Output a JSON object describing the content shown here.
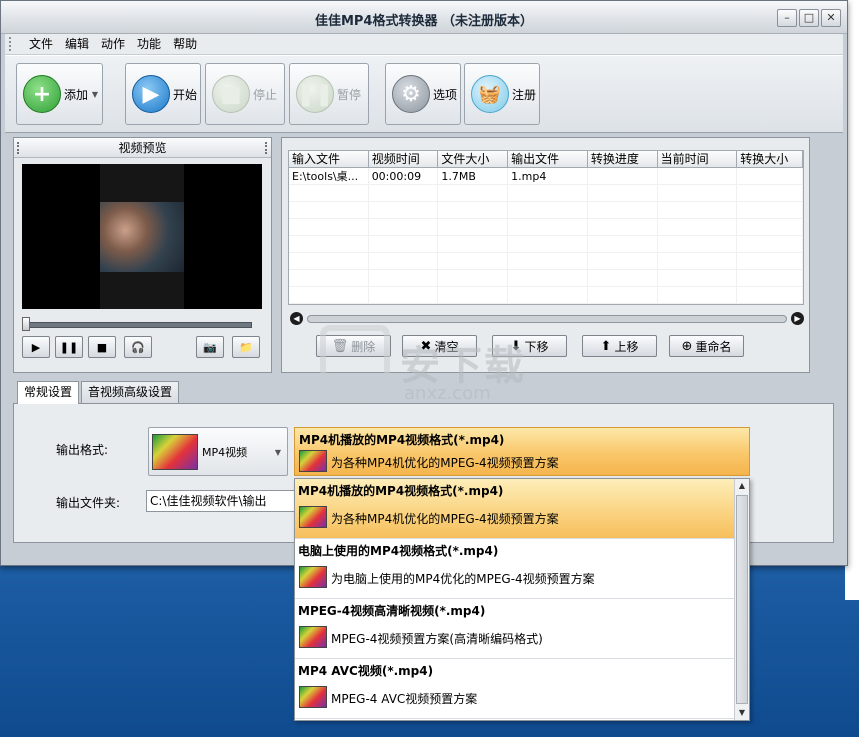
{
  "window": {
    "title": "佳佳MP4格式转换器 （未注册版本）",
    "controls": {
      "minimize": "–",
      "maximize": "□",
      "close": "✕"
    }
  },
  "menu": [
    "文件",
    "编辑",
    "动作",
    "功能",
    "帮助"
  ],
  "toolbar": {
    "add": "添加",
    "start": "开始",
    "stop": "停止",
    "pause": "暂停",
    "options": "选项",
    "register": "注册"
  },
  "preview": {
    "title": "视频预览"
  },
  "file_list": {
    "columns": [
      "输入文件",
      "视频时间",
      "文件大小",
      "输出文件",
      "转换进度",
      "当前时间",
      "转换大小"
    ],
    "rows": [
      [
        "E:\\tools\\桌...",
        "00:00:09",
        "1.7MB",
        "1.mp4",
        "",
        "",
        ""
      ]
    ]
  },
  "list_actions": {
    "delete": "删除",
    "clear": "清空",
    "move_down": "下移",
    "move_up": "上移",
    "rename": "重命名"
  },
  "watermark": {
    "text": "安下载",
    "sub": "anxz.com"
  },
  "tabs": [
    "常规设置",
    "音视频高级设置"
  ],
  "settings": {
    "output_format_label": "输出格式:",
    "output_folder_label": "输出文件夹:",
    "format_value": "MP4视频",
    "folder_value": "C:\\佳佳视频软件\\输出",
    "preset_title": "MP4机播放的MP4视频格式(*.mp4)",
    "preset_desc": "为各种MP4机优化的MPEG-4视频预置方案"
  },
  "dropdown_items": [
    {
      "title": "MP4机播放的MP4视频格式(*.mp4)",
      "desc": "为各种MP4机优化的MPEG-4视频预置方案"
    },
    {
      "title": "电脑上使用的MP4视频格式(*.mp4)",
      "desc": "为电脑上使用的MP4优化的MPEG-4视频预置方案"
    },
    {
      "title": "MPEG-4视频高清晰视频(*.mp4)",
      "desc": "MPEG-4视频预置方案(高清晰编码格式)"
    },
    {
      "title": "MP4 AVC视频(*.mp4)",
      "desc": "MPEG-4 AVC视频预置方案"
    }
  ],
  "colors": {
    "selected_highlight": "#f9c76b",
    "window_bg": "#c7cdd5",
    "desktop_bg": "#1a5fa6"
  }
}
